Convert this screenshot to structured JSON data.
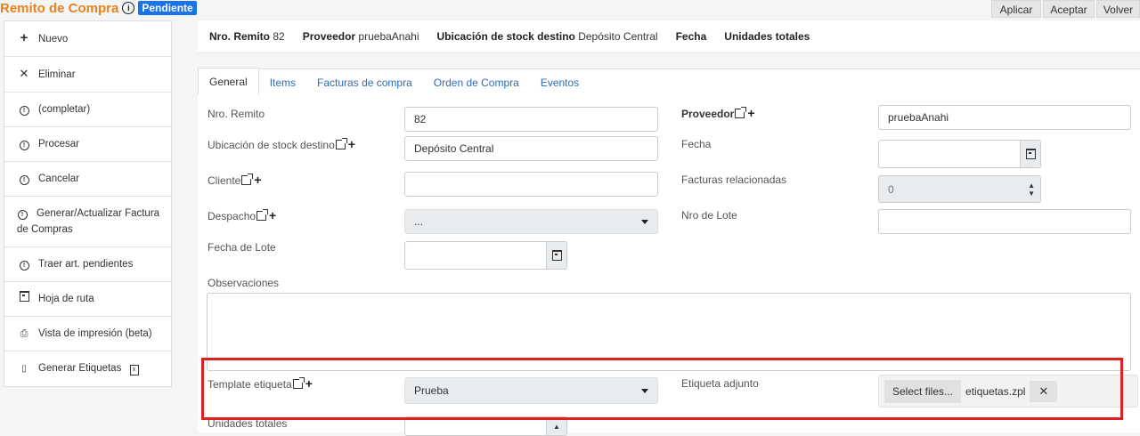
{
  "header": {
    "title": "Remito de Compra",
    "info_icon": "info-circle-icon",
    "status": "Pendiente",
    "status_color": "#1a73e8",
    "title_color": "#e8821a"
  },
  "top_buttons": {
    "apply": "Aplicar",
    "accept": "Aceptar",
    "back": "Volver"
  },
  "sidebar": {
    "items": [
      {
        "icon": "plus-icon",
        "label": "Nuevo"
      },
      {
        "icon": "close-icon",
        "label": "Eliminar"
      },
      {
        "icon": "info-circle-icon",
        "label": "(completar)"
      },
      {
        "icon": "info-circle-icon",
        "label": "Procesar"
      },
      {
        "icon": "info-circle-icon",
        "label": "Cancelar"
      },
      {
        "icon": "info-circle-icon",
        "label": "Generar/Actualizar Factura de Compras"
      },
      {
        "icon": "info-circle-icon",
        "label": "Traer art. pendientes"
      },
      {
        "icon": "calendar-icon",
        "label": "Hoja de ruta"
      },
      {
        "icon": "print-icon",
        "label": "Vista de impresión (beta)"
      },
      {
        "icon": "pdf-icon",
        "label": "Generar Etiquetas",
        "trailing_icon": "excel-icon"
      }
    ]
  },
  "summary": {
    "remito_label": "Nro. Remito",
    "remito_value": "82",
    "proveedor_label": "Proveedor",
    "proveedor_value": "pruebaAnahi",
    "ubicacion_label": "Ubicación de stock destino",
    "ubicacion_value": "Depósito Central",
    "fecha_label": "Fecha",
    "unidades_label": "Unidades totales"
  },
  "tabs": [
    "General",
    "Items",
    "Facturas de compra",
    "Orden de Compra",
    "Eventos"
  ],
  "form": {
    "nro_remito": {
      "label": "Nro. Remito",
      "value": "82"
    },
    "ubicacion": {
      "label": "Ubicación de stock destino",
      "value": "Depósito Central"
    },
    "cliente": {
      "label": "Cliente",
      "value": ""
    },
    "despacho": {
      "label": "Despacho",
      "value": "..."
    },
    "fecha_lote": {
      "label": "Fecha de Lote",
      "value": ""
    },
    "observaciones": {
      "label": "Observaciones",
      "value": ""
    },
    "template_etiqueta": {
      "label": "Template etiqueta",
      "value": "Prueba"
    },
    "unidades_totales": {
      "label": "Unidades totales"
    },
    "proveedor": {
      "label": "Proveedor",
      "value": "pruebaAnahi"
    },
    "fecha": {
      "label": "Fecha",
      "value": ""
    },
    "facturas_relacionadas": {
      "label": "Facturas relacionadas",
      "value": "0"
    },
    "nro_lote": {
      "label": "Nro de Lote",
      "value": ""
    },
    "etiqueta_adjunto": {
      "label": "Etiqueta adjunto",
      "button": "Select files...",
      "file": "etiquetas.zpl"
    }
  },
  "highlight_color": "#e02020"
}
